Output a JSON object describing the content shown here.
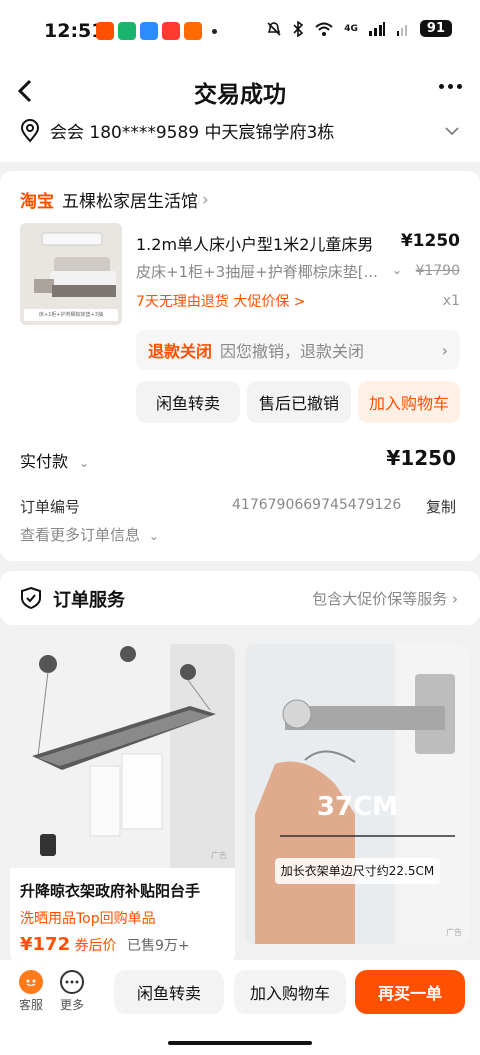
{
  "status_bar": {
    "time": "12:51",
    "network": "4G",
    "battery": "91"
  },
  "header": {
    "title": "交易成功"
  },
  "address": {
    "text": "会会  180****9589  中天宸锦学府3栋"
  },
  "shop": {
    "logo": "淘宝",
    "name": "五棵松家居生活馆"
  },
  "product": {
    "name": "1.2m单人床小户型1米2儿童床男",
    "price": "¥1250",
    "sku": "皮床+1柜+3抽屉+护脊椰棕床垫[...",
    "original_price": "¥1790",
    "promo": "7天无理由退货  大促价保 >",
    "quantity": "x1",
    "thumb_tag": "床+1柜+护脊椰棕床垫+3抽"
  },
  "refund": {
    "status": "退款关闭",
    "description": "因您撤销，退款关闭"
  },
  "order_actions": {
    "xianyu": "闲鱼转卖",
    "aftersale": "售后已撤销",
    "add_cart": "加入购物车"
  },
  "payment": {
    "label": "实付款",
    "amount": "¥1250"
  },
  "order_info": {
    "number_label": "订单编号",
    "number_value": "4176790669745479126",
    "copy": "复制",
    "more": "查看更多订单信息"
  },
  "service": {
    "title": "订单服务",
    "right_text": "包含大促价保等服务"
  },
  "recommendations": [
    {
      "title": "升降晾衣架政府补贴阳台手",
      "tag": "洗晒用品Top回购单品",
      "price": "¥172",
      "price_suffix": "券后价",
      "sold": "已售9万+",
      "ad": "广告"
    },
    {
      "cm_label": "37CM",
      "caption": "加长衣架单边尺寸约22.5CM",
      "ad": "广告"
    }
  ],
  "bottom_bar": {
    "service_label": "客服",
    "more_label": "更多",
    "xianyu": "闲鱼转卖",
    "add_cart": "加入购物车",
    "rebuy": "再买一单"
  },
  "colors": {
    "accent": "#ff5000",
    "background": "#f1f1f1"
  }
}
